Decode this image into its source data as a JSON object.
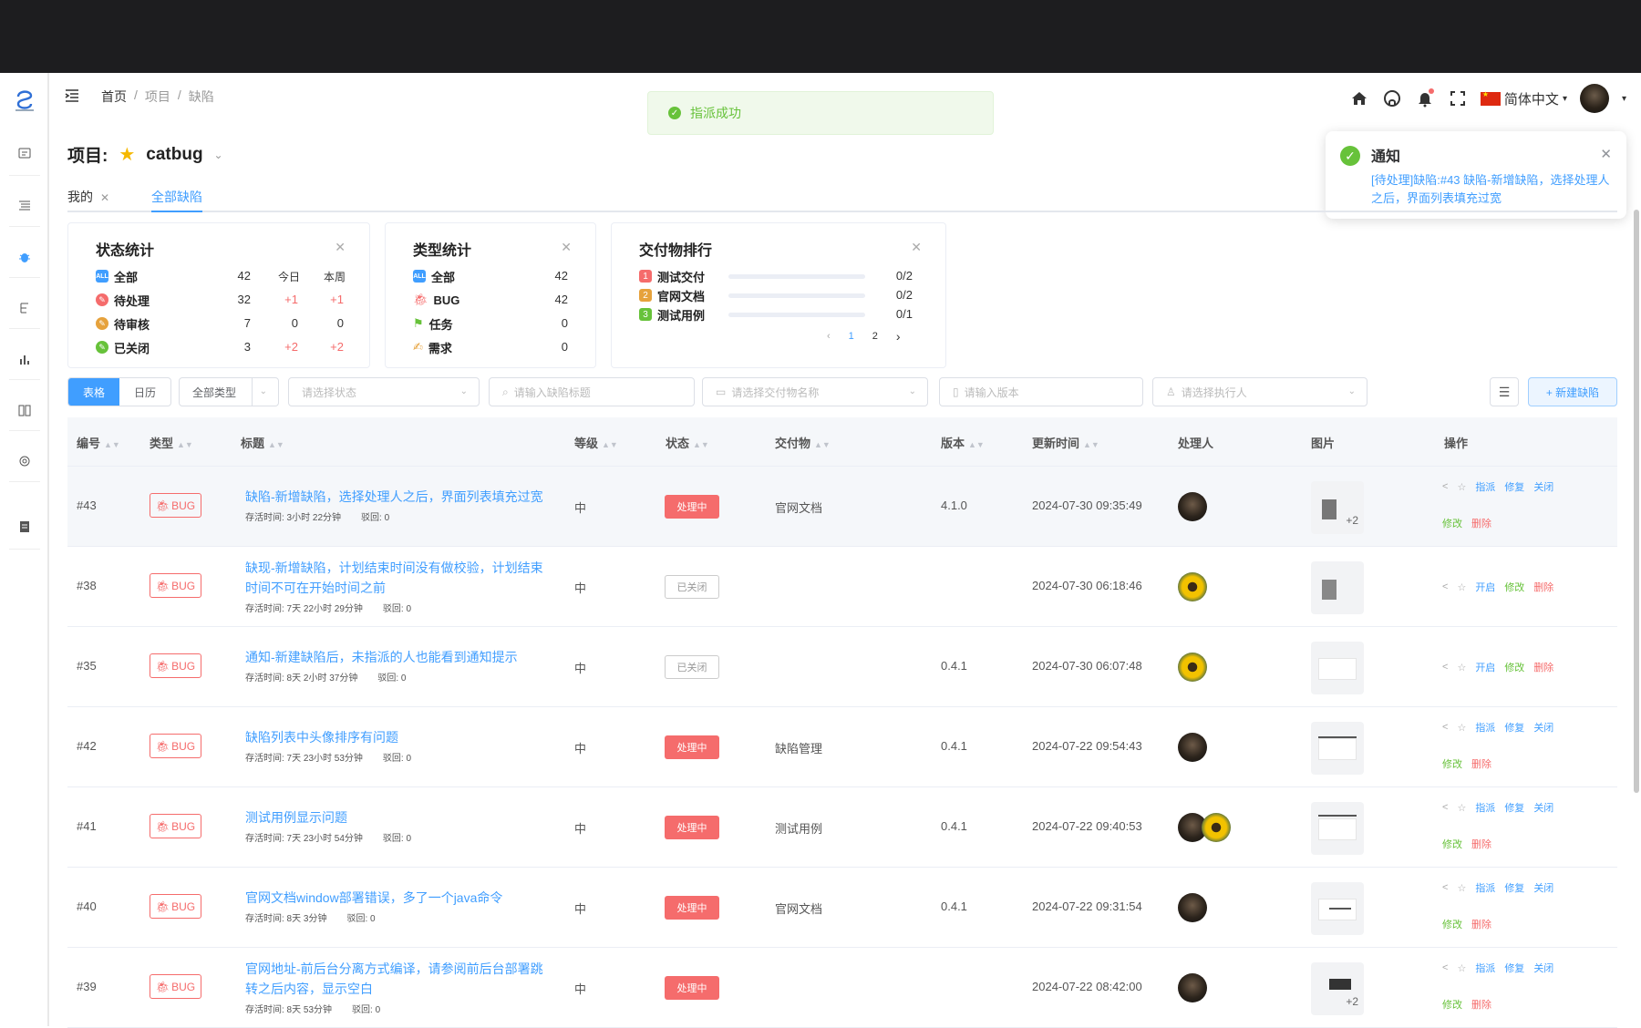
{
  "breadcrumb": [
    "首页",
    "项目",
    "缺陷"
  ],
  "header": {
    "language": "简体中文"
  },
  "toast": {
    "message": "指派成功"
  },
  "notification": {
    "title": "通知",
    "body": "[待处理]缺陷:#43 缺陷-新增缺陷，选择处理人之后，界面列表填充过宽"
  },
  "project": {
    "label": "项目:",
    "name": "catbug"
  },
  "tabs": [
    {
      "label": "我的"
    },
    {
      "label": "全部缺陷"
    }
  ],
  "status_stats": {
    "title": "状态统计",
    "headers": [
      "今日",
      "本周"
    ],
    "rows": [
      {
        "label": "全部",
        "total": "42",
        "today": "",
        "week": ""
      },
      {
        "label": "待处理",
        "total": "32",
        "today": "+1",
        "week": "+1"
      },
      {
        "label": "待审核",
        "total": "7",
        "today": "0",
        "week": "0"
      },
      {
        "label": "已关闭",
        "total": "3",
        "today": "+2",
        "week": "+2"
      }
    ]
  },
  "type_stats": {
    "title": "类型统计",
    "rows": [
      {
        "label": "全部",
        "count": "42"
      },
      {
        "label": "BUG",
        "count": "42"
      },
      {
        "label": "任务",
        "count": "0"
      },
      {
        "label": "需求",
        "count": "0"
      }
    ]
  },
  "deliverable_rank": {
    "title": "交付物排行",
    "rows": [
      {
        "rank": "1",
        "label": "测试交付",
        "ratio": "0/2"
      },
      {
        "rank": "2",
        "label": "官网文档",
        "ratio": "0/2"
      },
      {
        "rank": "3",
        "label": "测试用例",
        "ratio": "0/1"
      }
    ],
    "pages": [
      "1",
      "2"
    ]
  },
  "filters": {
    "view_table": "表格",
    "view_calendar": "日历",
    "type_select": "全部类型",
    "status_placeholder": "请选择状态",
    "title_placeholder": "请输入缺陷标题",
    "deliverable_placeholder": "请选择交付物名称",
    "version_placeholder": "请输入版本",
    "assignee_placeholder": "请选择执行人",
    "new_button": "+ 新建缺陷"
  },
  "columns": [
    "编号",
    "类型",
    "标题",
    "等级",
    "状态",
    "交付物",
    "版本",
    "更新时间",
    "处理人",
    "图片",
    "操作"
  ],
  "rows": [
    {
      "id": "#43",
      "type": "BUG",
      "title": "缺陷-新增缺陷，选择处理人之后，界面列表填充过宽",
      "alive": "存活时间: 3小时 22分钟",
      "reject": "驳回: 0",
      "level": "中",
      "status": "处理中",
      "deliverable": "官网文档",
      "version": "4.1.0",
      "updated": "2024-07-30 09:35:49",
      "img_more": "+2",
      "ops": [
        "指派",
        "修复",
        "关闭",
        "修改",
        "删除"
      ]
    },
    {
      "id": "#38",
      "type": "BUG",
      "title": "缺现-新增缺陷，计划结束时间没有做校验，计划结束时间不可在开始时间之前",
      "alive": "存活时间: 7天 22小时 29分钟",
      "reject": "驳回: 0",
      "level": "中",
      "status": "已关闭",
      "deliverable": "",
      "version": "",
      "updated": "2024-07-30 06:18:46",
      "img_more": "",
      "ops": [
        "开启",
        "修改",
        "删除"
      ]
    },
    {
      "id": "#35",
      "type": "BUG",
      "title": "通知-新建缺陷后，未指派的人也能看到通知提示",
      "alive": "存活时间: 8天 2小时 37分钟",
      "reject": "驳回: 0",
      "level": "中",
      "status": "已关闭",
      "deliverable": "",
      "version": "0.4.1",
      "updated": "2024-07-30 06:07:48",
      "img_more": "",
      "ops": [
        "开启",
        "修改",
        "删除"
      ]
    },
    {
      "id": "#42",
      "type": "BUG",
      "title": "缺陷列表中头像排序有问题",
      "alive": "存活时间: 7天 23小时 53分钟",
      "reject": "驳回: 0",
      "level": "中",
      "status": "处理中",
      "deliverable": "缺陷管理",
      "version": "0.4.1",
      "updated": "2024-07-22 09:54:43",
      "img_more": "",
      "ops": [
        "指派",
        "修复",
        "关闭",
        "修改",
        "删除"
      ]
    },
    {
      "id": "#41",
      "type": "BUG",
      "title": "测试用例显示问题",
      "alive": "存活时间: 7天 23小时 54分钟",
      "reject": "驳回: 0",
      "level": "中",
      "status": "处理中",
      "deliverable": "测试用例",
      "version": "0.4.1",
      "updated": "2024-07-22 09:40:53",
      "img_more": "",
      "ops": [
        "指派",
        "修复",
        "关闭",
        "修改",
        "删除"
      ]
    },
    {
      "id": "#40",
      "type": "BUG",
      "title": "官网文档window部署错误，多了一个java命令",
      "alive": "存活时间: 8天 3分钟",
      "reject": "驳回: 0",
      "level": "中",
      "status": "处理中",
      "deliverable": "官网文档",
      "version": "0.4.1",
      "updated": "2024-07-22 09:31:54",
      "img_more": "",
      "ops": [
        "指派",
        "修复",
        "关闭",
        "修改",
        "删除"
      ]
    },
    {
      "id": "#39",
      "type": "BUG",
      "title": "官网地址-前后台分离方式编译，请参阅前后台部署跳转之后内容，显示空白",
      "alive": "存活时间: 8天 53分钟",
      "reject": "驳回: 0",
      "level": "中",
      "status": "处理中",
      "deliverable": "",
      "version": "",
      "updated": "2024-07-22 08:42:00",
      "img_more": "+2",
      "ops": [
        "指派",
        "修复",
        "关闭",
        "修改",
        "删除"
      ]
    }
  ]
}
